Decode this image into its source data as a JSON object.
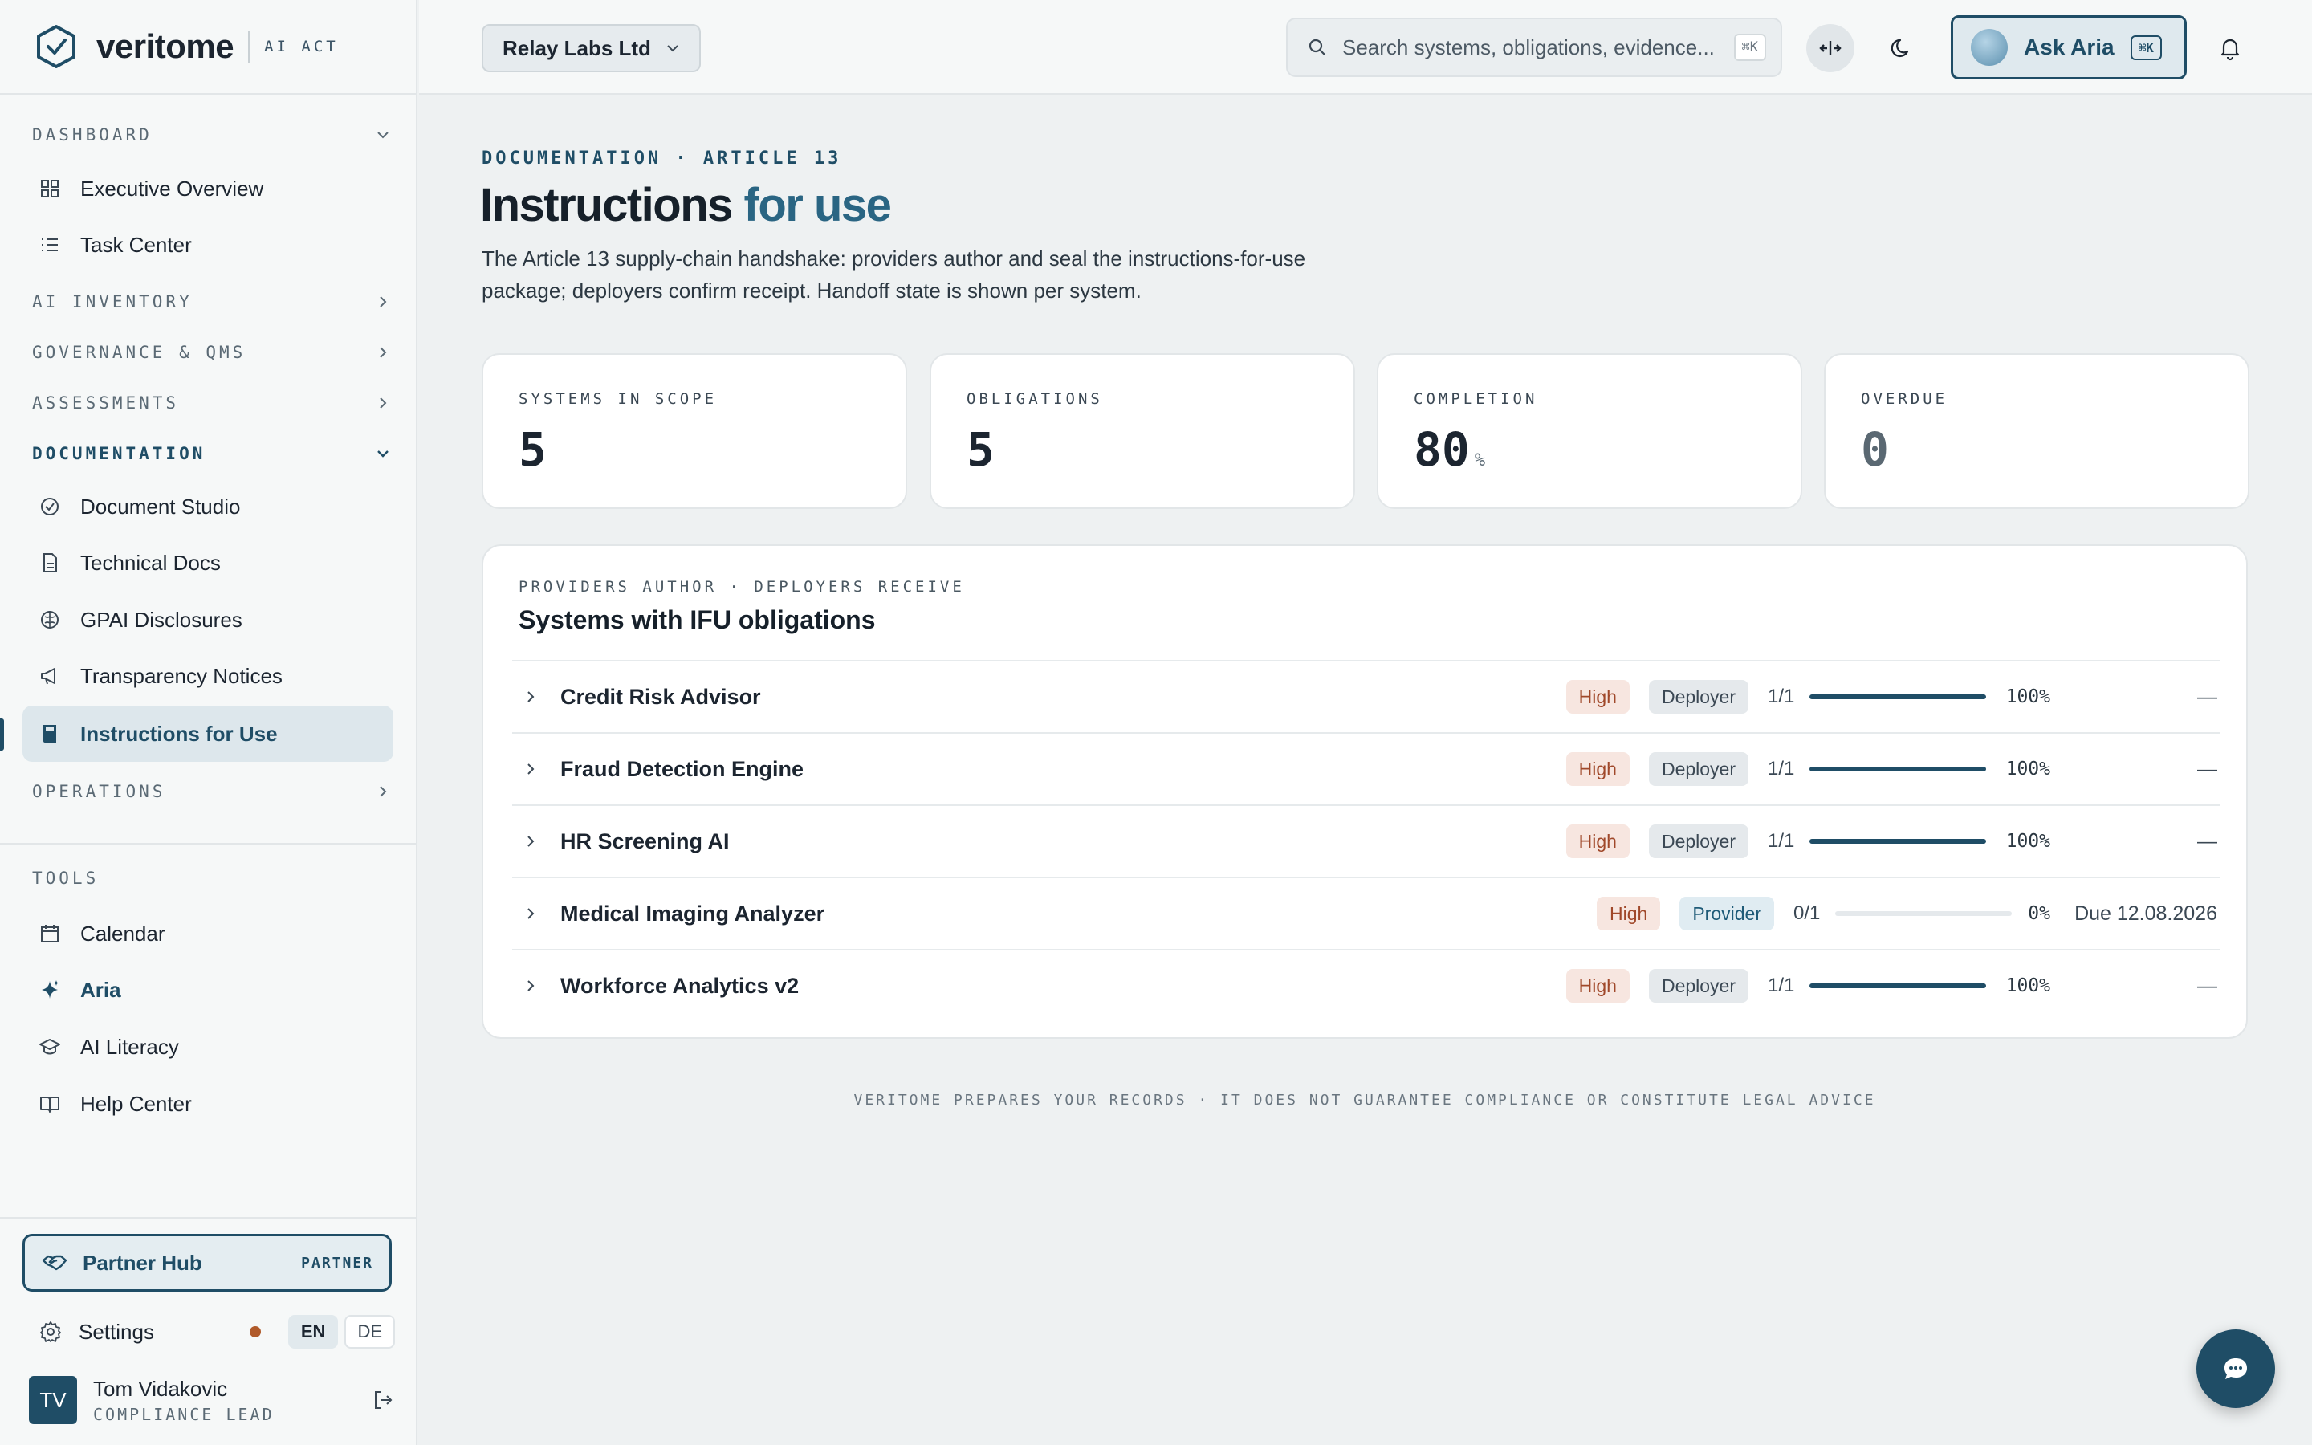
{
  "brand": {
    "name": "veritome",
    "tag": "AI ACT"
  },
  "sidebar": {
    "sections": [
      {
        "label": "DASHBOARD"
      },
      {
        "label": "AI INVENTORY"
      },
      {
        "label": "GOVERNANCE & QMS"
      },
      {
        "label": "ASSESSMENTS"
      },
      {
        "label": "DOCUMENTATION"
      },
      {
        "label": "OPERATIONS"
      }
    ],
    "dashboard_items": [
      {
        "label": "Executive Overview",
        "icon": "grid-icon"
      },
      {
        "label": "Task Center",
        "icon": "list-icon"
      }
    ],
    "documentation_items": [
      {
        "label": "Document Studio",
        "icon": "badge-check-icon"
      },
      {
        "label": "Technical Docs",
        "icon": "file-icon"
      },
      {
        "label": "GPAI Disclosures",
        "icon": "brain-icon"
      },
      {
        "label": "Transparency Notices",
        "icon": "megaphone-icon"
      },
      {
        "label": "Instructions for Use",
        "icon": "book-icon"
      }
    ],
    "tools_label": "TOOLS",
    "tools_items": [
      {
        "label": "Calendar",
        "icon": "calendar-icon"
      },
      {
        "label": "Aria",
        "icon": "sparkle-icon"
      },
      {
        "label": "AI Literacy",
        "icon": "graduation-cap-icon"
      },
      {
        "label": "Help Center",
        "icon": "open-book-icon"
      }
    ],
    "partner": {
      "label": "Partner Hub",
      "badge": "PARTNER"
    },
    "settings": {
      "label": "Settings",
      "lang_en": "EN",
      "lang_de": "DE"
    },
    "user": {
      "initials": "TV",
      "name": "Tom Vidakovic",
      "role": "COMPLIANCE LEAD"
    }
  },
  "topbar": {
    "org": "Relay Labs Ltd",
    "search_placeholder": "Search systems, obligations, evidence...",
    "search_shortcut": "⌘K",
    "ask_label": "Ask Aria",
    "ask_shortcut": "⌘K"
  },
  "page": {
    "eyebrow": "DOCUMENTATION · ARTICLE 13",
    "title_main": "Instructions",
    "title_accent": "for use",
    "description": "The Article 13 supply-chain handshake: providers author and seal the instructions-for-use package; deployers confirm receipt. Handoff state is shown per system."
  },
  "stats": [
    {
      "label": "SYSTEMS IN SCOPE",
      "value": "5",
      "unit": ""
    },
    {
      "label": "OBLIGATIONS",
      "value": "5",
      "unit": ""
    },
    {
      "label": "COMPLETION",
      "value": "80",
      "unit": "%"
    },
    {
      "label": "OVERDUE",
      "value": "0",
      "unit": ""
    }
  ],
  "systems": {
    "eyebrow": "PROVIDERS AUTHOR · DEPLOYERS RECEIVE",
    "title": "Systems with IFU obligations",
    "rows": [
      {
        "name": "Credit Risk Advisor",
        "risk": "High",
        "role": "Deployer",
        "fraction": "1/1",
        "progress": 1.0,
        "percent": "100%",
        "due": "—"
      },
      {
        "name": "Fraud Detection Engine",
        "risk": "High",
        "role": "Deployer",
        "fraction": "1/1",
        "progress": 1.0,
        "percent": "100%",
        "due": "—"
      },
      {
        "name": "HR Screening AI",
        "risk": "High",
        "role": "Deployer",
        "fraction": "1/1",
        "progress": 1.0,
        "percent": "100%",
        "due": "—"
      },
      {
        "name": "Medical Imaging Analyzer",
        "risk": "High",
        "role": "Provider",
        "fraction": "0/1",
        "progress": 0.0,
        "percent": "0%",
        "due": "Due 12.08.2026"
      },
      {
        "name": "Workforce Analytics v2",
        "risk": "High",
        "role": "Deployer",
        "fraction": "1/1",
        "progress": 1.0,
        "percent": "100%",
        "due": "—"
      }
    ]
  },
  "footer": "VERITOME PREPARES YOUR RECORDS · IT DOES NOT GUARANTEE COMPLIANCE OR CONSTITUTE LEGAL ADVICE",
  "colors": {
    "accent": "#1f4d66",
    "high_risk": "#a0482a",
    "background": "#eef1f2"
  }
}
